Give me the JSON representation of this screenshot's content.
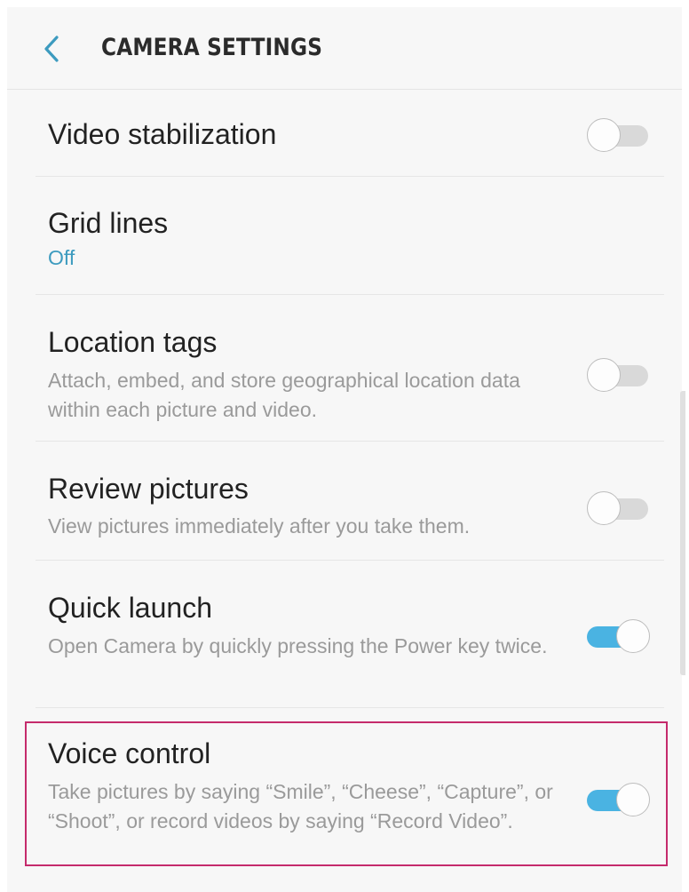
{
  "header": {
    "back_icon": "chevron-left-icon",
    "title": "CAMERA SETTINGS"
  },
  "settings": {
    "video_stabilization": {
      "title": "Video stabilization",
      "toggle_on": false
    },
    "grid_lines": {
      "title": "Grid lines",
      "value": "Off"
    },
    "location_tags": {
      "title": "Location tags",
      "description": "Attach, embed, and store geographical location data within each picture and video.",
      "toggle_on": false
    },
    "review_pictures": {
      "title": "Review pictures",
      "description": "View pictures immediately after you take them.",
      "toggle_on": false
    },
    "quick_launch": {
      "title": "Quick launch",
      "description": "Open Camera by quickly pressing the Power key twice.",
      "toggle_on": true
    },
    "voice_control": {
      "title": "Voice control",
      "description": "Take pictures by saying “Smile”, “Cheese”, “Capture”, or “Shoot”, or record videos by saying “Record Video”.",
      "toggle_on": true
    }
  },
  "colors": {
    "accent": "#4ab3e2",
    "value_text": "#3d9bbf",
    "highlight": "#c52b6c",
    "toggle_off": "#d9d9d9"
  }
}
